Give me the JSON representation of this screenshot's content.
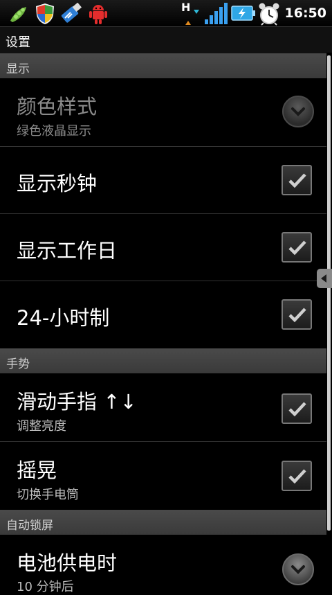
{
  "status_bar": {
    "time": "16:50",
    "network_letter": "H",
    "icons": [
      "peapod-icon",
      "shield-icon",
      "usb-icon",
      "android-icon",
      "network-h-icon",
      "signal-icon",
      "battery-charging-icon",
      "alarm-clock-icon"
    ]
  },
  "title_bar": {
    "title": "设置"
  },
  "sections": [
    {
      "header": "显示"
    },
    {
      "header": "手势"
    },
    {
      "header": "自动锁屏"
    }
  ],
  "rows": [
    {
      "title": "颜色样式",
      "summary": "绿色液晶显示",
      "control": "dropdown",
      "enabled": false
    },
    {
      "title": "显示秒钟",
      "control": "checkbox",
      "checked": true
    },
    {
      "title": "显示工作日",
      "control": "checkbox",
      "checked": true
    },
    {
      "title": "24-小时制",
      "control": "checkbox",
      "checked": true
    },
    {
      "title": "滑动手指 ↑↓",
      "summary": "调整亮度",
      "control": "checkbox",
      "checked": true
    },
    {
      "title": "摇晃",
      "summary": "切换手电筒",
      "control": "checkbox",
      "checked": true
    },
    {
      "title": "电池供电时",
      "summary": "10 分钟后",
      "control": "dropdown"
    }
  ],
  "colors": {
    "background": "#000000",
    "section_header": "#444444",
    "check_mark": "#cfcfcf",
    "disabled_text": "#8a8a8a"
  }
}
